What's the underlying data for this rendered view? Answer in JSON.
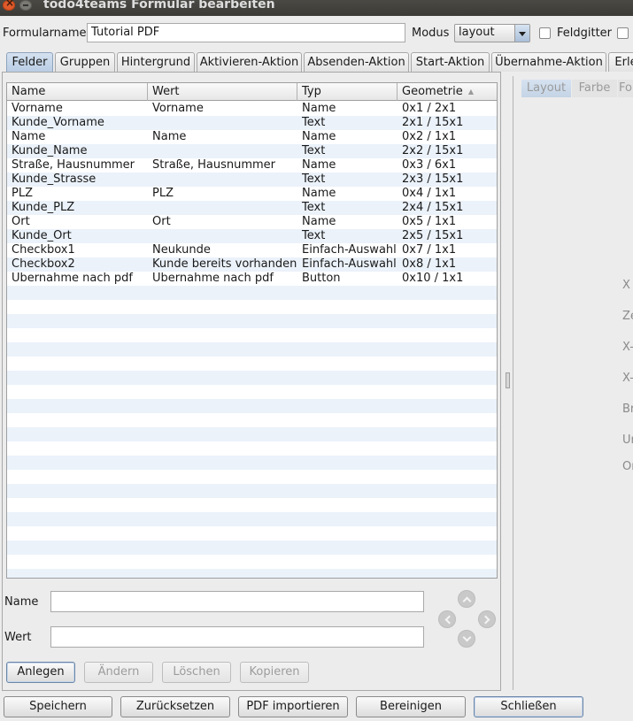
{
  "window": {
    "title": "todo4teams Formular bearbeiten"
  },
  "header": {
    "formname_label": "Formularname",
    "formname_value": "Tutorial PDF",
    "modus_label": "Modus",
    "modus_value": "layout",
    "feldgitter_label": "Feldgitter",
    "feldgitter_checked": false
  },
  "tabs": [
    "Felder",
    "Gruppen",
    "Hintergrund",
    "Aktivieren-Aktion",
    "Absenden-Aktion",
    "Start-Aktion",
    "Übernahme-Aktion",
    "Erle"
  ],
  "active_tab": "Felder",
  "table": {
    "columns": [
      "Name",
      "Wert",
      "Typ",
      "Geometrie"
    ],
    "sort_indicator": "▲",
    "rows": [
      [
        "Vorname",
        "Vorname",
        "Name",
        "0x1 / 2x1"
      ],
      [
        "Kunde_Vorname",
        "",
        "Text",
        "2x1 / 15x1"
      ],
      [
        "Name",
        "Name",
        "Name",
        "0x2 / 1x1"
      ],
      [
        "Kunde_Name",
        "",
        "Text",
        "2x2 / 15x1"
      ],
      [
        "Straße, Hausnummer",
        "Straße, Hausnummer",
        "Name",
        "0x3 / 6x1"
      ],
      [
        "Kunde_Strasse",
        "",
        "Text",
        "2x3 / 15x1"
      ],
      [
        "PLZ",
        "PLZ",
        "Name",
        "0x4 / 1x1"
      ],
      [
        "Kunde_PLZ",
        "",
        "Text",
        "2x4 / 15x1"
      ],
      [
        "Ort",
        "Ort",
        "Name",
        "0x5 / 1x1"
      ],
      [
        "Kunde_Ort",
        "",
        "Text",
        "2x5 / 15x1"
      ],
      [
        "Checkbox1",
        "Neukunde",
        "Einfach-Auswahl",
        "0x7 / 1x1"
      ],
      [
        "Checkbox2",
        "Kunde bereits vorhanden",
        "Einfach-Auswahl",
        "0x8 / 1x1"
      ],
      [
        "Übernahme nach pdf",
        "Übernahme nach pdf",
        "Button",
        "0x10 / 1x1"
      ]
    ]
  },
  "editor": {
    "name_label": "Name",
    "name_value": "",
    "wert_label": "Wert",
    "wert_value": ""
  },
  "row_buttons": {
    "anlegen": "Anlegen",
    "aendern": "Ändern",
    "loeschen": "Löschen",
    "kopieren": "Kopieren"
  },
  "bottom_buttons": {
    "speichern": "Speichern",
    "zuruecksetzen": "Zurücksetzen",
    "pdf_importieren": "PDF importieren",
    "bereinigen": "Bereinigen",
    "schliessen": "Schließen"
  },
  "right_panel": {
    "tabs": [
      "Layout",
      "Farbe",
      "Fo"
    ],
    "active_tab": "Layout",
    "labels": [
      "X",
      "Ze",
      "X-l",
      "X-e",
      "Br",
      "Ur",
      "Or"
    ]
  }
}
